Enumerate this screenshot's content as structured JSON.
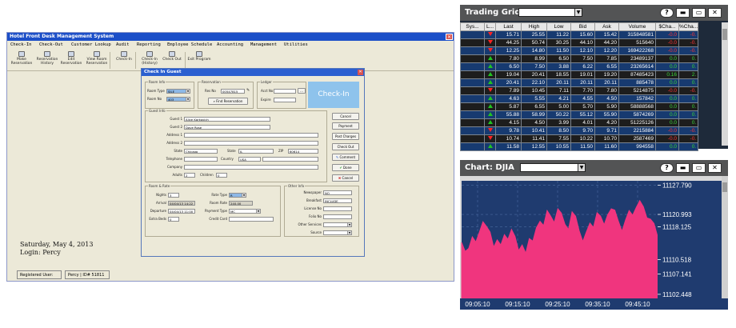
{
  "hotel": {
    "title": "Hotel Front Desk Management System",
    "menu": [
      "Check-In",
      "Check-Out",
      "Customer Lookup",
      "Audit",
      "Reporting",
      "Employee Schedule",
      "Accounting",
      "Management",
      "Utilities"
    ],
    "toolbar": [
      {
        "label": "Make Reservation",
        "icon": "reservation-icon"
      },
      {
        "label": "Reservation History",
        "icon": "history-icon"
      },
      {
        "label": "Edit Reservation",
        "icon": "edit-icon"
      },
      {
        "label": "View Room Reservation",
        "icon": "room-icon"
      },
      {
        "label": "Check-In",
        "icon": "checkin-icon"
      },
      {
        "label": "Check-In (History)",
        "icon": "checkin-history-icon"
      },
      {
        "label": "Check Out",
        "icon": "checkout-icon"
      },
      {
        "label": "Exit Program",
        "icon": "exit-icon"
      }
    ],
    "date_line": "Saturday, May 4, 2013",
    "login_line": "Login: Percy",
    "status": {
      "registered_label": "Registered User:",
      "user": "Percy | ID# 51811"
    }
  },
  "dialog": {
    "title": "Check In Guest",
    "close": "✕",
    "room_info": {
      "label": "Room Info",
      "room_type_label": "Room Type",
      "room_type": "SILE",
      "room_no_label": "Room No",
      "room_no": "403"
    },
    "reservation": {
      "label": "Reservation",
      "res_no_label": "Res No",
      "res_no": "00547815",
      "find_button": "Find Reservation"
    },
    "ledger": {
      "label": "Ledger",
      "acct_label": "Acct No",
      "acct_dots": "...",
      "expire_label": "Expire"
    },
    "checkin_button": "Check-In",
    "guest_info": {
      "label": "Guest Info",
      "guest1_label": "Guest 1",
      "guest1": "Alice Karkovich",
      "guest2_label": "Guest 2",
      "guest2": "Dave Rose",
      "address1_label": "Address 1",
      "address2_label": "Address 2",
      "city_label": "State",
      "city": "Chicago",
      "state_label": "State",
      "state": "IL",
      "zip_label": "ZIP",
      "zip": "60614",
      "telephone_label": "Telephone",
      "country_label": "Country",
      "country": "USA",
      "company_label": "Company",
      "adults_label": "Adults",
      "adults": "2",
      "children_label": "Children",
      "children": "0"
    },
    "side_buttons": [
      "Cancel",
      "Payment",
      "Post Charges",
      "Check Out"
    ],
    "comment_button": "Comment",
    "done_button": "Done",
    "cancel_button": "Cancel",
    "room_rate": {
      "label": "Room & Rate",
      "nights_label": "Nights",
      "nights": "3",
      "arrival_label": "Arrival",
      "arrival": "04/04/13  14:22",
      "departure_label": "Departure",
      "departure": "04/04/13  11:00",
      "extra_beds_label": "Extra Beds",
      "extra_beds": "0",
      "rate_type_label": "Rate Type",
      "rate_type": "R",
      "room_rate_label": "Room Rate",
      "room_rate": "240.00",
      "payment_type_label": "Payment Type",
      "payment_type": "MC",
      "credit_card_label": "Credit Card"
    },
    "other_info": {
      "label": "Other Info",
      "newspaper_label": "Newspaper",
      "newspaper": "NO",
      "breakfast_label": "Breakfast",
      "breakfast": "INCLUDE",
      "license_label": "License No",
      "folio_label": "Folio No",
      "other_services_label": "Other Services",
      "source_label": "Source"
    }
  },
  "trading_grid": {
    "title": "Trading Grid",
    "buttons": {
      "help": "?",
      "minimize": "▬",
      "maximize": "▭",
      "close": "✕"
    },
    "columns": [
      "Sys...",
      "L...",
      "Last",
      "High",
      "Low",
      "Bid",
      "Ask",
      "Volume",
      "$Cha...",
      "%Cha..."
    ],
    "rows": [
      {
        "dir": "down",
        "last": "15.71",
        "high": "25.55",
        "low": "11.22",
        "bid": "15.60",
        "ask": "15.42",
        "volume": "315848581",
        "chg": "-0.0",
        "pct": "-0.",
        "style": "blue"
      },
      {
        "dir": "down",
        "last": "44.25",
        "high": "50.74",
        "low": "30.25",
        "bid": "44.10",
        "ask": "44.20",
        "volume": "515640",
        "chg": "-0.0",
        "pct": "-0.",
        "style": "dark"
      },
      {
        "dir": "down",
        "last": "12.25",
        "high": "14.80",
        "low": "11.50",
        "bid": "12.10",
        "ask": "12.20",
        "volume": "169422268",
        "chg": "-0.0",
        "pct": "-0.",
        "style": "blue"
      },
      {
        "dir": "up",
        "last": "7.80",
        "high": "8.99",
        "low": "6.50",
        "bid": "7.50",
        "ask": "7.85",
        "volume": "23489137",
        "chg": "0.0",
        "pct": "0.",
        "style": "dark"
      },
      {
        "dir": "up",
        "last": "6.50",
        "high": "7.50",
        "low": "3.88",
        "bid": "6.22",
        "ask": "6.55",
        "volume": "23265614",
        "chg": "0.0",
        "pct": "0.",
        "style": "blue"
      },
      {
        "dir": "up",
        "last": "19.04",
        "high": "20.41",
        "low": "18.55",
        "bid": "19.01",
        "ask": "19.20",
        "volume": "87485423",
        "chg": "0.16",
        "pct": "2.",
        "style": "dark"
      },
      {
        "dir": "up",
        "last": "20.41",
        "high": "22.10",
        "low": "20.11",
        "bid": "20.11",
        "ask": "20.11",
        "volume": "885478",
        "chg": "0.0",
        "pct": "0.",
        "style": "blue"
      },
      {
        "dir": "down",
        "last": "7.89",
        "high": "10.45",
        "low": "7.11",
        "bid": "7.70",
        "ask": "7.80",
        "volume": "5214875",
        "chg": "-0.0",
        "pct": "-0.",
        "style": "dark"
      },
      {
        "dir": "up",
        "last": "4.63",
        "high": "5.55",
        "low": "4.21",
        "bid": "4.55",
        "ask": "4.50",
        "volume": "157842",
        "chg": "0.0",
        "pct": "0.",
        "style": "blue"
      },
      {
        "dir": "up",
        "last": "5.87",
        "high": "6.55",
        "low": "5.00",
        "bid": "5.70",
        "ask": "5.90",
        "volume": "58888568",
        "chg": "0.0",
        "pct": "0.",
        "style": "dark"
      },
      {
        "dir": "up",
        "last": "55.88",
        "high": "58.99",
        "low": "50.22",
        "bid": "55.12",
        "ask": "55.90",
        "volume": "5874269",
        "chg": "0.0",
        "pct": "0.",
        "style": "blue"
      },
      {
        "dir": "up",
        "last": "4.15",
        "high": "4.50",
        "low": "3.99",
        "bid": "4.01",
        "ask": "4.20",
        "volume": "51225126",
        "chg": "0.0",
        "pct": "0.",
        "style": "dark"
      },
      {
        "dir": "down",
        "last": "9.78",
        "high": "10.41",
        "low": "8.50",
        "bid": "9.70",
        "ask": "9.71",
        "volume": "2215884",
        "chg": "-0.0",
        "pct": "-0.",
        "style": "blue"
      },
      {
        "dir": "down",
        "last": "10.74",
        "high": "11.41",
        "low": "7.55",
        "bid": "10.22",
        "ask": "10.70",
        "volume": "2587469",
        "chg": "-0.0",
        "pct": "-0.",
        "style": "dark"
      },
      {
        "dir": "up",
        "last": "11.58",
        "high": "12.55",
        "low": "10.55",
        "bid": "11.50",
        "ask": "11.60",
        "volume": "994558",
        "chg": "0.0",
        "pct": "0.",
        "style": "blue"
      }
    ],
    "colors": {
      "up": "#21c421",
      "down": "#ff2222",
      "row_blue": "#173a70",
      "row_dark": "#1d1d1d"
    }
  },
  "chart_panel": {
    "title": "Chart: DJIA",
    "buttons": {
      "help": "?",
      "minimize": "▬",
      "maximize": "▭",
      "close": "✕"
    }
  },
  "chart_data": {
    "type": "area",
    "title": "Chart: DJIA",
    "xlabel": "",
    "ylabel": "",
    "x_ticks": [
      "09:05:10",
      "09:15:10",
      "09:25:10",
      "09:35:10",
      "09:45:10"
    ],
    "y_ticks": [
      11102.448,
      11107.141,
      11110.518,
      11118.125,
      11120.993,
      11127.79
    ],
    "ylim": [
      11101.5,
      11128.8
    ],
    "series": [
      {
        "values": [
          11114.5,
          11112.4,
          11113.1,
          11115.8,
          11114.6,
          11116.9,
          11119.3,
          11118.2,
          11116.9,
          11113.4,
          11115.1,
          11113.9,
          11116.3,
          11115.2,
          11117.5,
          11115.9,
          11112.6,
          11113.9,
          11112.0,
          11115.4,
          11114.8,
          11117.9,
          11119.4,
          11118.4,
          11121.9,
          11120.6,
          11119.1,
          11122.3,
          11121.3,
          11118.7,
          11117.5,
          11121.6,
          11120.6,
          11117.2,
          11114.7,
          11116.9,
          11119.0,
          11118.0,
          11121.4,
          11120.6,
          11118.6,
          11120.9,
          11122.3,
          11122.0,
          11119.4,
          11117.1,
          11119.7,
          11121.9,
          11120.8,
          11122.6,
          11124.2,
          11122.8,
          11120.2,
          11119.9,
          11118.9,
          11115.9
        ]
      }
    ],
    "grid": true,
    "colors": {
      "fill": "#f0357e",
      "background": "#1f3b6f",
      "grid": "#4a6aa0",
      "text": "#ffffff"
    }
  }
}
